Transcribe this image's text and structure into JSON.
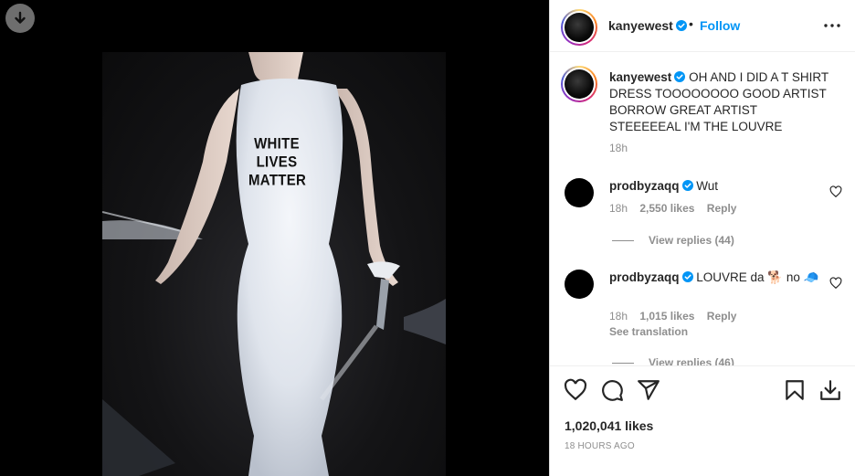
{
  "post": {
    "author": "kanyewest",
    "follow_label": "Follow",
    "dot": "•",
    "image_overlay_text": [
      "WHITE",
      "LIVES",
      "MATTER"
    ]
  },
  "caption": {
    "username": "kanyewest",
    "text": "OH AND I DID A T SHIRT DRESS TOOOOOOOO GOOD ARTIST BORROW GREAT ARTIST STEEEEEAL I'M THE LOUVRE",
    "time": "18h"
  },
  "comments": [
    {
      "username": "prodbyzaqq",
      "text": "Wut",
      "time": "18h",
      "likes": "2,550 likes",
      "reply_label": "Reply",
      "view_replies": "View replies (44)"
    },
    {
      "username": "prodbyzaqq",
      "text": "LOUVRE da 🐕 no 🧢",
      "time": "18h",
      "likes": "1,015 likes",
      "reply_label": "Reply",
      "see_translation": "See translation",
      "view_replies": "View replies (46)"
    }
  ],
  "footer": {
    "likes": "1,020,041 likes",
    "posted_ago": "18 HOURS AGO"
  },
  "colors": {
    "accent": "#0095f6",
    "secondary_text": "#8e8e8e",
    "primary_text": "#262626"
  },
  "icons": [
    "download-icon",
    "verified-badge-icon",
    "more-options-icon",
    "heart-icon",
    "comment-icon",
    "share-icon",
    "bookmark-icon",
    "save-download-icon"
  ]
}
